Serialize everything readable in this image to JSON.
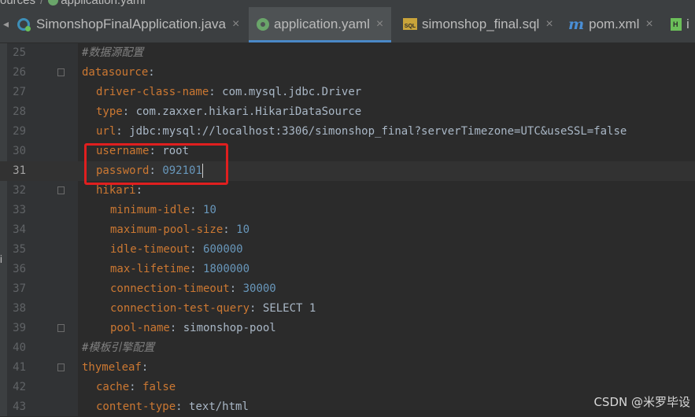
{
  "breadcrumb": [
    "ources",
    "application.yaml"
  ],
  "tabs": [
    {
      "label": "SimonshopFinalApplication.java",
      "icon": "java-class-icon",
      "active": false
    },
    {
      "label": "application.yaml",
      "icon": "yaml-icon",
      "active": true
    },
    {
      "label": "simonshop_final.sql",
      "icon": "sql-icon",
      "active": false
    },
    {
      "label": "pom.xml",
      "icon": "maven-icon",
      "active": false
    },
    {
      "label": "i",
      "icon": "html-icon",
      "active": false
    }
  ],
  "close_glyph": "×",
  "left_panel_fragment": "ti",
  "editor": {
    "current_line": 31,
    "lines": [
      {
        "n": "25",
        "indent": 0,
        "comment": "#数据源配置"
      },
      {
        "n": "26",
        "indent": 0,
        "key": "datasource",
        "fold": true
      },
      {
        "n": "27",
        "indent": 1,
        "key": "driver-class-name",
        "val": "com.mysql.jdbc.Driver"
      },
      {
        "n": "28",
        "indent": 1,
        "key": "type",
        "val": "com.zaxxer.hikari.HikariDataSource"
      },
      {
        "n": "29",
        "indent": 1,
        "key": "url",
        "val": "jdbc:mysql://localhost:3306/simonshop_final?serverTimezone=UTC&useSSL=false"
      },
      {
        "n": "30",
        "indent": 1,
        "key": "username",
        "val": "root"
      },
      {
        "n": "31",
        "indent": 1,
        "key": "password",
        "num": "092101",
        "caret": true
      },
      {
        "n": "32",
        "indent": 1,
        "key": "hikari",
        "fold": true
      },
      {
        "n": "33",
        "indent": 2,
        "key": "minimum-idle",
        "num": "10"
      },
      {
        "n": "34",
        "indent": 2,
        "key": "maximum-pool-size",
        "num": "10"
      },
      {
        "n": "35",
        "indent": 2,
        "key": "idle-timeout",
        "num": "600000"
      },
      {
        "n": "36",
        "indent": 2,
        "key": "max-lifetime",
        "num": "1800000"
      },
      {
        "n": "37",
        "indent": 2,
        "key": "connection-timeout",
        "num": "30000"
      },
      {
        "n": "38",
        "indent": 2,
        "key": "connection-test-query",
        "val": "SELECT 1"
      },
      {
        "n": "39",
        "indent": 2,
        "key": "pool-name",
        "val": "simonshop-pool",
        "fold": true
      },
      {
        "n": "40",
        "indent": 0,
        "comment": "#模板引擎配置"
      },
      {
        "n": "41",
        "indent": 0,
        "key": "thymeleaf",
        "fold": true
      },
      {
        "n": "42",
        "indent": 1,
        "key": "cache",
        "kwval": "false"
      },
      {
        "n": "43",
        "indent": 1,
        "key": "content-type",
        "val": "text/html"
      }
    ]
  },
  "watermark": "CSDN @米罗毕设",
  "colors": {
    "key": "#cc7832",
    "number": "#6897bb",
    "comment": "#808080",
    "text": "#a9b7c6",
    "highlight": "#e01f1f"
  }
}
